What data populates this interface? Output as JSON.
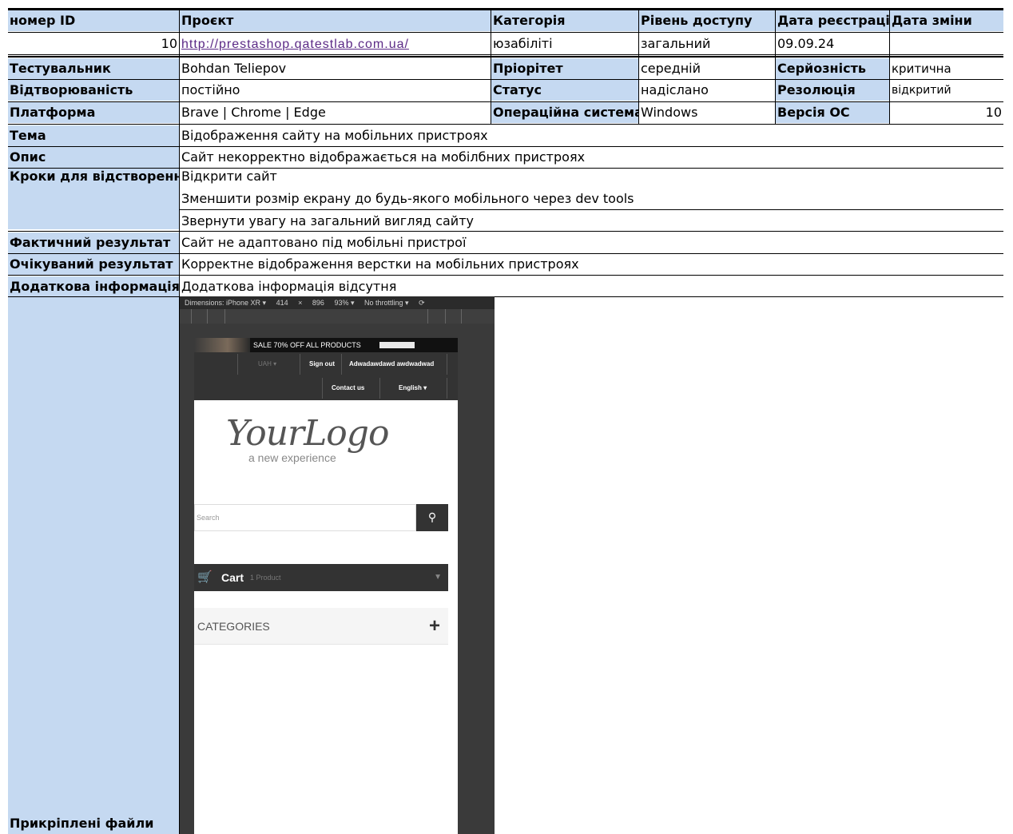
{
  "header": {
    "id": "номер ID",
    "project": "Проєкт",
    "category": "Категорія",
    "access": "Рівень доступу",
    "reg_date": "Дата реєстрації",
    "change_date": "Дата зміни"
  },
  "record": {
    "id": "10",
    "project_url": "http://prestashop.qatestlab.com.ua/",
    "category": "юзабіліті",
    "access": "загальний",
    "reg_date": "09.09.24",
    "change_date": ""
  },
  "rows": {
    "tester_label": "Тестувальник",
    "tester": "Bohdan Teliepov",
    "priority_label": "Пріорітет",
    "priority": "середній",
    "severity_label": "Серйозність",
    "severity": "критична",
    "repro_label": "Відтворюваність",
    "repro": "постійно",
    "status_label": "Статус",
    "status": "надіслано",
    "resolution_label": "Резолюція",
    "resolution": "відкритий",
    "platform_label": "Платформа",
    "platform": "Brave | Chrome | Edge",
    "os_label": "Операційна система",
    "os": "Windows",
    "os_ver_label": "Версія ОС",
    "os_ver": "10",
    "topic_label": "Тема",
    "topic": "Відображення сайту на мобільних пристроях",
    "desc_label": "Опис",
    "desc": "Сайт некорректно відображається на мобілбних пристроях",
    "steps_label": "Кроки для відстворення",
    "steps": [
      "Відкрити сайт",
      "Зменшити розмір екрану до будь-якого мобільного через dev tools",
      "Звернути увагу на загальний вигляд сайту"
    ],
    "actual_label": "Фактичний результат",
    "actual": "Сайт не адаптовано під мобільні пристрої",
    "expected_label": "Очікуваний результат",
    "expected": "Корректне відображення верстки на мобільних пристроях",
    "extra_label": "Додаткова інформація",
    "extra": "Додаткова інформація відсутня",
    "files_label": "Прикріплені файли"
  },
  "screenshot": {
    "devtools": {
      "dimensions": "Dimensions: iPhone XR ▾",
      "width": "414",
      "x": "×",
      "height": "896",
      "zoom": "93% ▾",
      "throttle": "No throttling ▾"
    },
    "promo": "SALE 70% OFF ALL PRODUCTS",
    "currency": "UAH ▾",
    "sign_out": "Sign out",
    "user": "Adwadawdawd awdwadwad",
    "contact": "Contact us",
    "language": "English ▾",
    "logo": "YourLogo",
    "logo_sub": "a new experience",
    "search_placeholder": "Search",
    "cart_label": "Cart",
    "cart_count": "1 Product",
    "categories": "CATEGORIES"
  }
}
